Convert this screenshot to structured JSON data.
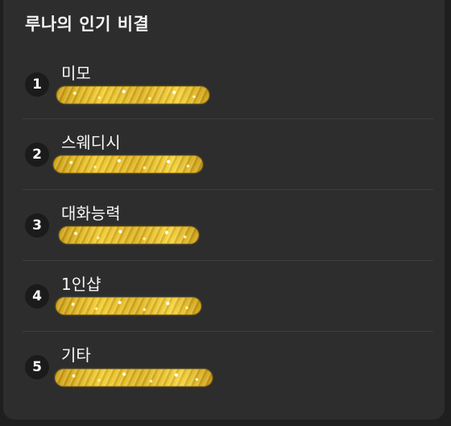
{
  "card": {
    "title": "루나의 인기 비결"
  },
  "items": [
    {
      "rank": "1",
      "label": "미모"
    },
    {
      "rank": "2",
      "label": "스웨디시"
    },
    {
      "rank": "3",
      "label": "대화능력"
    },
    {
      "rank": "4",
      "label": "1인샵"
    },
    {
      "rank": "5",
      "label": "기타"
    }
  ],
  "colors": {
    "background": "#2d2d2d",
    "badge": "#1b1b1b",
    "text": "#f2f2f2",
    "glitter": "#f1cb32"
  }
}
